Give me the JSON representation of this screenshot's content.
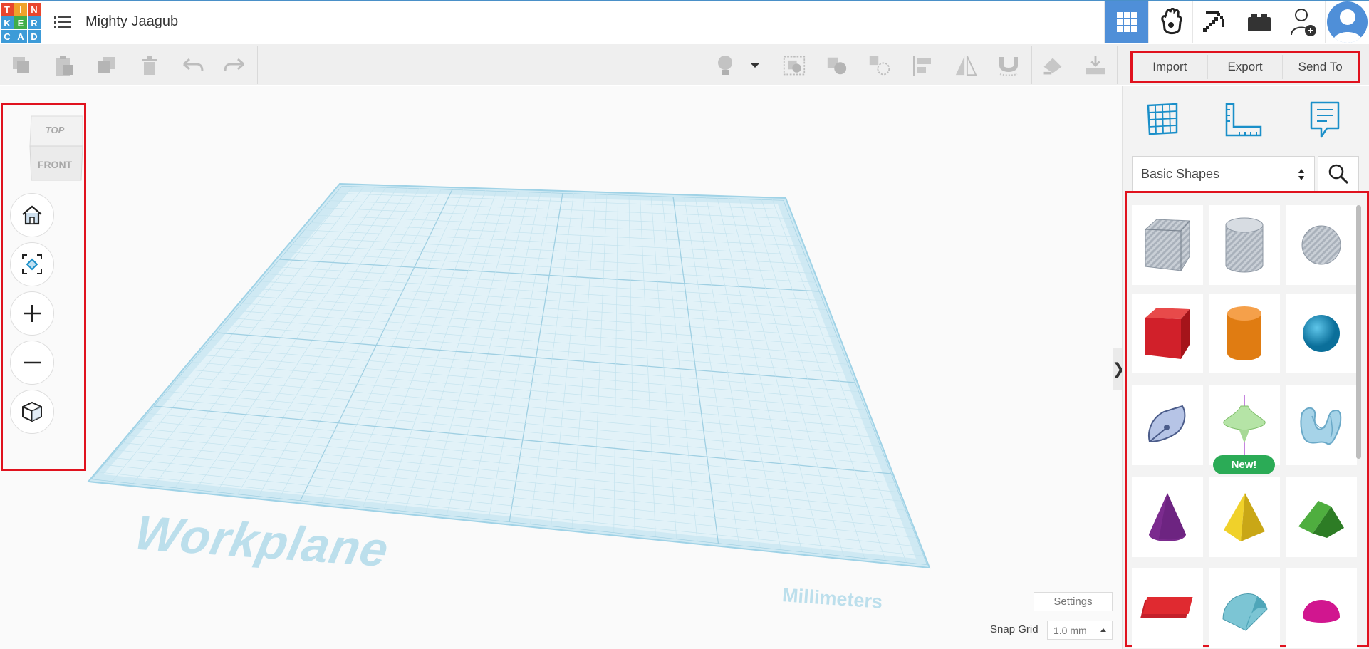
{
  "app": {
    "logo_letters": [
      "T",
      "I",
      "N",
      "K",
      "E",
      "R",
      "C",
      "A",
      "D"
    ],
    "design_title": "Mighty Jaagub"
  },
  "topbar_buttons": [
    {
      "name": "3d-design-view",
      "icon": "grid-icon",
      "active": true
    },
    {
      "name": "circuits",
      "icon": "glove-hand-icon",
      "active": false
    },
    {
      "name": "codeblocks",
      "icon": "pickaxe-icon",
      "active": false
    },
    {
      "name": "lego-bricks",
      "icon": "brick-icon",
      "active": false
    },
    {
      "name": "invite-collaborator",
      "icon": "add-user-icon",
      "active": false
    }
  ],
  "toolbar": {
    "left_tools": [
      "copy-icon",
      "paste-icon",
      "duplicate-icon",
      "delete-icon",
      "undo-icon",
      "redo-icon"
    ],
    "right_tools": [
      "light-bulb-icon",
      "dropdown-caret-icon",
      "group-icon",
      "ungroup-icon",
      "hole-icon",
      "align-icon",
      "mirror-icon",
      "magnet-icon",
      "paint-icon",
      "drop-icon"
    ],
    "import_label": "Import",
    "export_label": "Export",
    "sendto_label": "Send To"
  },
  "viewcube": {
    "top_label": "TOP",
    "front_label": "FRONT"
  },
  "view_nav": [
    "home-icon",
    "fit-view-icon",
    "zoom-in-icon",
    "zoom-out-icon",
    "perspective-icon"
  ],
  "workplane": {
    "label": "Workplane",
    "units": "Millimeters",
    "settings_label": "Settings",
    "snap_grid_label": "Snap Grid",
    "snap_grid_value": "1.0 mm"
  },
  "panel": {
    "icons": [
      "workplane-grid-icon",
      "ruler-icon",
      "notes-icon"
    ],
    "library_selected": "Basic Shapes",
    "new_badge": "New!",
    "shapes": [
      "box-hole",
      "cylinder-hole",
      "sphere-hole",
      "box",
      "cylinder",
      "sphere",
      "scribble",
      "spinning-top",
      "text-hole",
      "cone",
      "pyramid",
      "roof",
      "text",
      "half-cylinder",
      "paraboloid"
    ]
  },
  "colors": {
    "accent_blue": "#4f8fd8",
    "highlight_red": "#e0121e",
    "workplane_blue": "#cfe9f3",
    "new_badge_green": "#2bab56"
  }
}
